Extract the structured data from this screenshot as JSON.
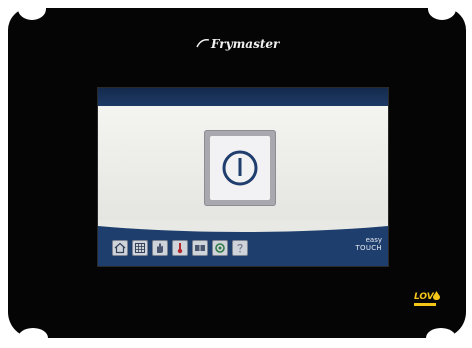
{
  "brand": {
    "name": "Frymaster"
  },
  "screen": {
    "power_button": {
      "icon": "power-icon"
    },
    "nav_icons": [
      {
        "name": "home-icon"
      },
      {
        "name": "grid-icon"
      },
      {
        "name": "hand-icon"
      },
      {
        "name": "thermometer-icon"
      },
      {
        "name": "book-icon"
      },
      {
        "name": "recycle-icon"
      },
      {
        "name": "help-icon"
      }
    ],
    "easytouch": {
      "line1": "easy",
      "line2": "TOUCH"
    }
  },
  "lov_logo": {
    "text": "LOV"
  },
  "colors": {
    "bezel": "#050505",
    "screen_header": "#1d3a66",
    "screen_body": "#f2f2ee",
    "power_frame": "#a8a8ae",
    "power_symbol": "#1f3e6d",
    "lov_yellow": "#f5c518"
  }
}
